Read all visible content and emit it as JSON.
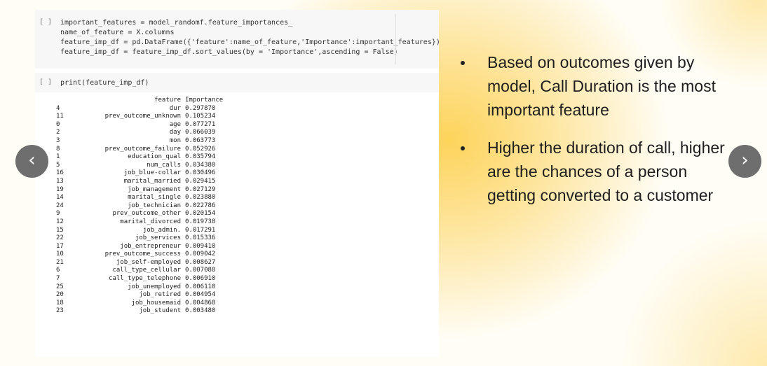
{
  "notebook": {
    "cell1": {
      "prompt": "[ ]",
      "lines": [
        "important_features = model_randomf.feature_importances_",
        "name_of_feature = X.columns",
        "feature_imp_df = pd.DataFrame({'feature':name_of_feature,'Importance':important_features})",
        "feature_imp_df = feature_imp_df.sort_values(by = 'Importance',ascending = False)"
      ]
    },
    "cell2": {
      "prompt": "[ ]",
      "code": "print(feature_imp_df)"
    },
    "output": {
      "headers": {
        "feature": "feature",
        "importance": "Importance"
      },
      "rows": [
        {
          "idx": "4",
          "feature": "dur",
          "importance": "0.297870"
        },
        {
          "idx": "11",
          "feature": "prev_outcome_unknown",
          "importance": "0.105234"
        },
        {
          "idx": "0",
          "feature": "age",
          "importance": "0.077271"
        },
        {
          "idx": "2",
          "feature": "day",
          "importance": "0.066039"
        },
        {
          "idx": "3",
          "feature": "mon",
          "importance": "0.063773"
        },
        {
          "idx": "8",
          "feature": "prev_outcome_failure",
          "importance": "0.052926"
        },
        {
          "idx": "1",
          "feature": "education_qual",
          "importance": "0.035794"
        },
        {
          "idx": "5",
          "feature": "num_calls",
          "importance": "0.034380"
        },
        {
          "idx": "16",
          "feature": "job_blue-collar",
          "importance": "0.030496"
        },
        {
          "idx": "13",
          "feature": "marital_married",
          "importance": "0.029415"
        },
        {
          "idx": "19",
          "feature": "job_management",
          "importance": "0.027129"
        },
        {
          "idx": "14",
          "feature": "marital_single",
          "importance": "0.023880"
        },
        {
          "idx": "24",
          "feature": "job_technician",
          "importance": "0.022786"
        },
        {
          "idx": "9",
          "feature": "prev_outcome_other",
          "importance": "0.020154"
        },
        {
          "idx": "12",
          "feature": "marital_divorced",
          "importance": "0.019738"
        },
        {
          "idx": "15",
          "feature": "job_admin.",
          "importance": "0.017291"
        },
        {
          "idx": "22",
          "feature": "job_services",
          "importance": "0.015336"
        },
        {
          "idx": "17",
          "feature": "job_entrepreneur",
          "importance": "0.009410"
        },
        {
          "idx": "10",
          "feature": "prev_outcome_success",
          "importance": "0.009042"
        },
        {
          "idx": "21",
          "feature": "job_self-employed",
          "importance": "0.008627"
        },
        {
          "idx": "6",
          "feature": "call_type_cellular",
          "importance": "0.007088"
        },
        {
          "idx": "7",
          "feature": "call_type_telephone",
          "importance": "0.006910"
        },
        {
          "idx": "25",
          "feature": "job_unemployed",
          "importance": "0.006110"
        },
        {
          "idx": "20",
          "feature": "job_retired",
          "importance": "0.004954"
        },
        {
          "idx": "18",
          "feature": "job_housemaid",
          "importance": "0.004868"
        },
        {
          "idx": "23",
          "feature": "job_student",
          "importance": "0.003480"
        }
      ]
    }
  },
  "bullets": [
    "Based on outcomes given by model, Call Duration is the most important feature",
    "Higher the duration of call, higher are the chances of a person getting converted to a customer"
  ],
  "nav": {
    "prev_icon": "chevron-left-icon",
    "prev_glyph": "‹",
    "next_icon": "chevron-right-icon",
    "next_glyph": "›"
  },
  "colors": {
    "accent": "#fdd35a",
    "nav_button": "#6e6e6e",
    "string_literal": "#b5452f",
    "keyword": "#2a7d2a"
  }
}
